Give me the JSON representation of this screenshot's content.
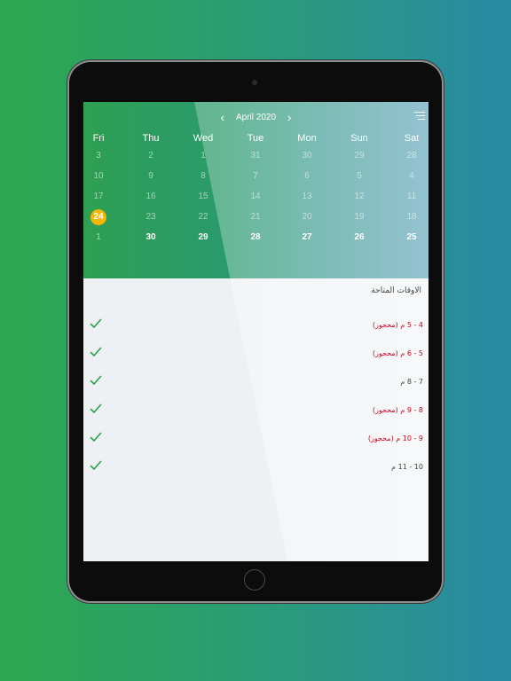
{
  "calendar": {
    "month_label": "April 2020",
    "prev_icon": "chevron-left-icon",
    "next_icon": "chevron-right-icon",
    "menu_icon": "menu-icon",
    "weekdays": [
      "Fri",
      "Thu",
      "Wed",
      "Tue",
      "Mon",
      "Sun",
      "Sat"
    ],
    "weeks": [
      [
        "3",
        "2",
        "1",
        "31",
        "30",
        "29",
        "28"
      ],
      [
        "10",
        "9",
        "8",
        "7",
        "6",
        "5",
        "4"
      ],
      [
        "17",
        "16",
        "15",
        "14",
        "13",
        "12",
        "11"
      ],
      [
        "24",
        "23",
        "22",
        "21",
        "20",
        "19",
        "18"
      ],
      [
        "1",
        "30",
        "29",
        "28",
        "27",
        "26",
        "25"
      ]
    ],
    "today": "24",
    "today_color": "#f2b705"
  },
  "slots": {
    "title": "الاوقات المتاحة",
    "items": [
      {
        "label": "4 - 5 م (محجوز)",
        "booked": true
      },
      {
        "label": "5 - 6 م (محجوز)",
        "booked": true
      },
      {
        "label": "7 - 8 م",
        "booked": false
      },
      {
        "label": "8 - 9 م (محجوز)",
        "booked": true
      },
      {
        "label": "9 - 10 م (محجوز)",
        "booked": true
      },
      {
        "label": "10 - 11 م",
        "booked": false
      }
    ],
    "check_icon": "checkmark-icon",
    "booked_color": "#d0021b",
    "check_color": "#2e9f52"
  }
}
